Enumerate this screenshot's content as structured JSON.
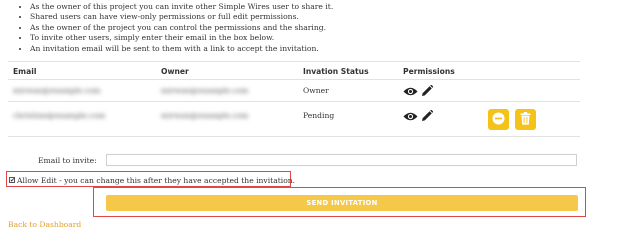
{
  "instructions": [
    "As the owner of this project you can invite other Simple Wires user to share it.",
    "Shared users can have view-only permissions or full edit permissions.",
    "As the owner of the project you can control the permissions and the sharing.",
    "To invite other users, simply enter their email in the box below.",
    "An invitation email will be sent to them with a link to accept the invitation."
  ],
  "table": {
    "headers": {
      "email": "Email",
      "owner": "Owner",
      "status": "Invation Status",
      "permissions": "Permissions"
    },
    "rows": [
      {
        "email": "mirwan@example.com",
        "owner": "mirwan@example.com",
        "status": "Owner",
        "permission_icons": [
          "eye-icon",
          "pencil-icon"
        ]
      },
      {
        "email": "christine@example.com",
        "owner": "mirwan@example.com",
        "status": "Pending",
        "permission_icons": [
          "eye-icon",
          "pencil-icon"
        ],
        "actions": [
          "minus-circle-icon",
          "trash-icon"
        ]
      }
    ]
  },
  "invite": {
    "email_label": "Email to invite:",
    "email_value": "",
    "allow_edit_label": "Allow Edit - you can change this after they have accepted the invitation.",
    "allow_edit_checked": true,
    "send_button_label": "SEND INVITATION"
  },
  "footer": {
    "back_link": "Back to Dashboard"
  },
  "colors": {
    "accent": "#f5c218",
    "send_button": "#f5c84a",
    "highlight_border": "#e04848",
    "link": "#e0a12a"
  }
}
